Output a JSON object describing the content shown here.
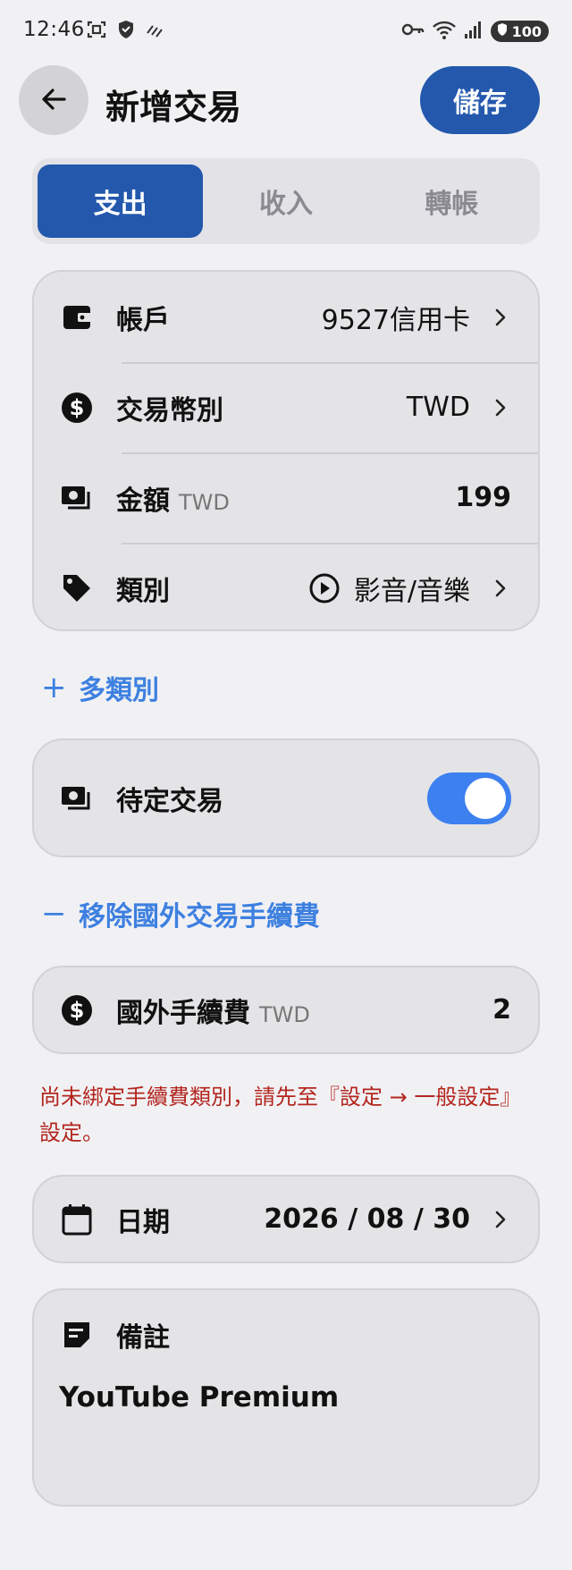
{
  "status": {
    "time": "12:46",
    "battery": "100"
  },
  "header": {
    "title": "新增交易",
    "save_label": "儲存"
  },
  "tabs": [
    {
      "label": "支出",
      "active": true
    },
    {
      "label": "收入",
      "active": false
    },
    {
      "label": "轉帳",
      "active": false
    }
  ],
  "details": {
    "account": {
      "label": "帳戶",
      "value": "9527信用卡"
    },
    "currency": {
      "label": "交易幣別",
      "value": "TWD"
    },
    "amount": {
      "label": "金額",
      "unit": "TWD",
      "value": "199"
    },
    "category": {
      "label": "類別",
      "value": "影音/音樂"
    }
  },
  "multi_category_label": "多類別",
  "pending": {
    "label": "待定交易",
    "enabled": true
  },
  "remove_fee_label": "移除國外交易手續費",
  "fee": {
    "label": "國外手續費",
    "unit": "TWD",
    "value": "2"
  },
  "warning": "尚未綁定手續費類別，請先至『設定 → 一般設定』設定。",
  "date": {
    "label": "日期",
    "value": "2026 / 08 / 30"
  },
  "note": {
    "label": "備註",
    "value": "YouTube Premium"
  },
  "colors": {
    "accent": "#2358ad",
    "link": "#3d80e0",
    "toggle_on": "#3d80f0",
    "warning": "#b3261e"
  }
}
